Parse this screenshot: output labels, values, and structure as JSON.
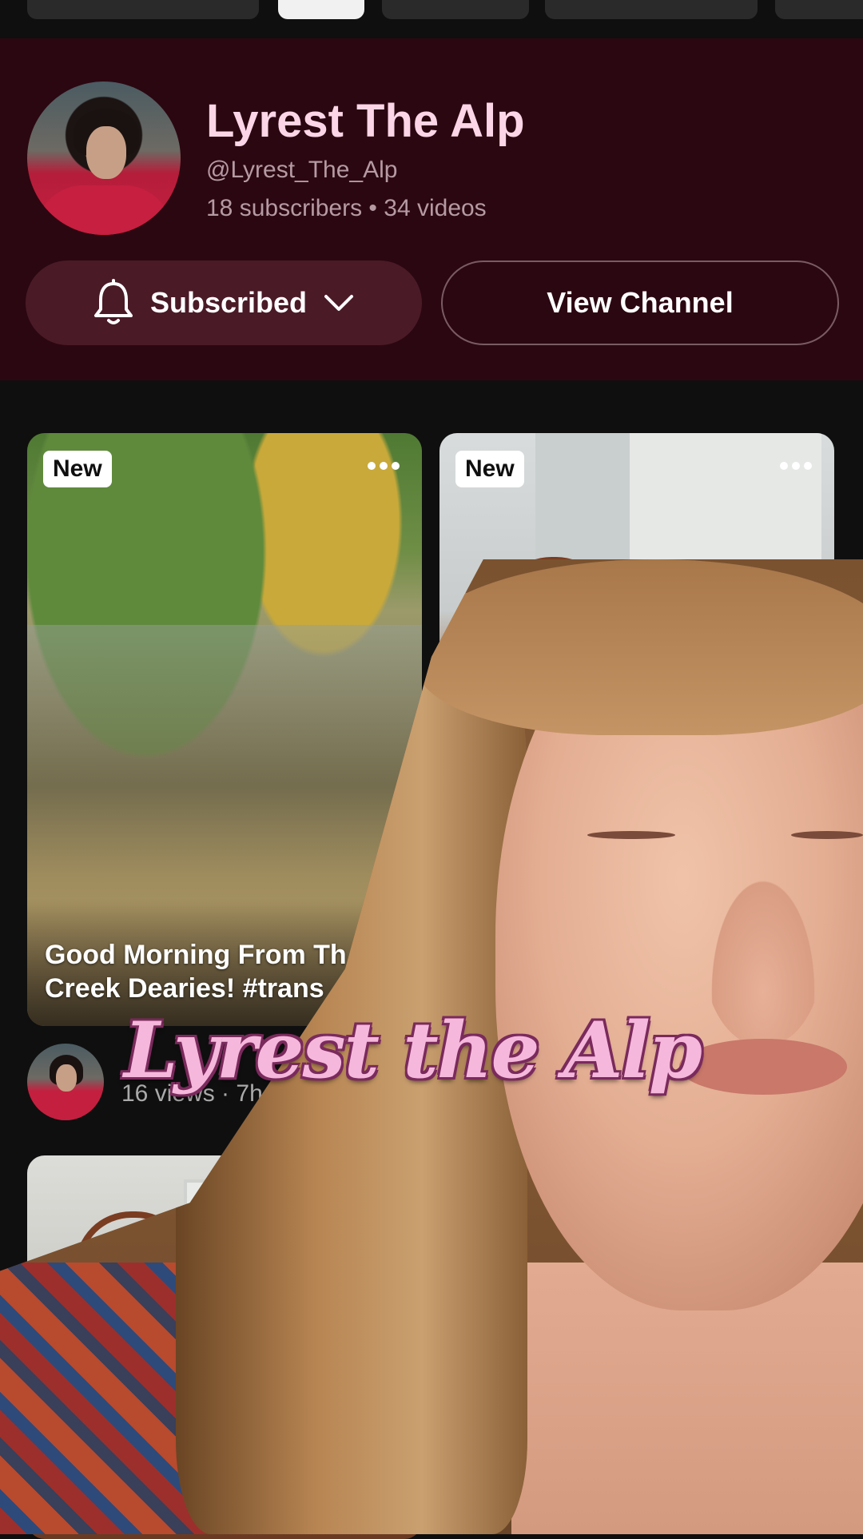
{
  "channel": {
    "name": "Lyrest The Alp",
    "handle": "@Lyrest_The_Alp",
    "stats": "18 subscribers • 34 videos",
    "subscribed_label": "Subscribed",
    "view_channel_label": "View Channel",
    "header_bg": "#2b0711",
    "title_color": "#fcd6e6"
  },
  "videos": [
    {
      "badge": "New",
      "title": "Good Morning From The Creek Dearies! #trans",
      "title_line1": "Good Morning From Th",
      "title_line2": "Creek Dearies! #trans",
      "meta": "16 views · 7h ago"
    },
    {
      "badge": "New"
    }
  ],
  "overlay": {
    "caption": "Lyrest the Alp",
    "caption_color": "#f5b8dc"
  },
  "icons": {
    "bell": "bell-icon",
    "chevron": "chevron-down-icon",
    "more": "more-horizontal-icon"
  }
}
